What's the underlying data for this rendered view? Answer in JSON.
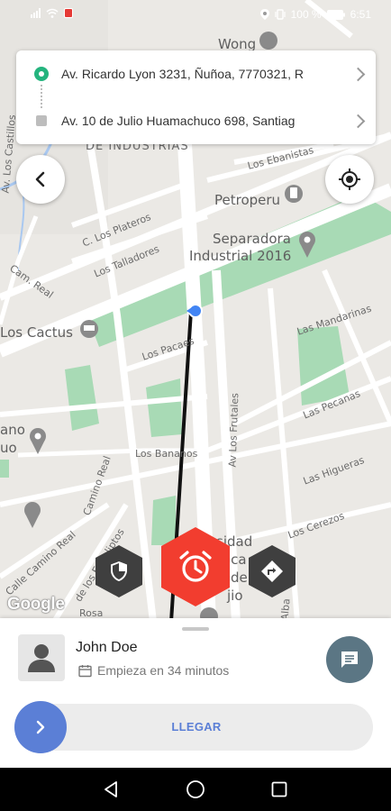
{
  "status_bar": {
    "battery": "100 %",
    "time": "6:51"
  },
  "route": {
    "origin_address": "Av. Ricardo Lyon 3231, Ñuñoa, 7770321, R",
    "destination_address": "Av. 10 de Julio Huamachuco 698, Santiag"
  },
  "map": {
    "labels": {
      "wong": "Wong",
      "de_industrias": "DE INDUSTRIAS",
      "los_ebanistas": "Los Ebanistas",
      "petroperu": "Petroperu",
      "los_plateros": "C. Los Plateros",
      "los_talladores": "Los Talladores",
      "separadora": "Separadora",
      "industrial_2016": "Industrial 2016",
      "cam_real": "Cam. Real",
      "los_cactus": "Los Cactus",
      "los_pacaes": "Los Pacaes",
      "las_mandarinas": "Las Mandarinas",
      "las_pecanas": "Las Pecanas",
      "av_los_frutales": "Av Los Frutales",
      "los_bananos": "Los Bananos",
      "las_higueras": "Las Higueras",
      "los_cerezos": "Los Cerezos",
      "camino_real": "Camino Real",
      "los_eucaliptos": "de los Eucaliptos",
      "calle_camino_real": "Calle Camino Real",
      "ano": "ano",
      "uo": "uo",
      "rosa": "Rosa",
      "alba": "Alba",
      "av_los_castillos": "Av. Los Castillos",
      "sidad": "sidad",
      "ica": "ica",
      "de": "de",
      "jio": "jio"
    },
    "attribution": "Google"
  },
  "driver": {
    "name": "John Doe",
    "starts_in": "Empieza en 34 minutos"
  },
  "slider": {
    "label": "LLEGAR"
  },
  "colors": {
    "accent_blue": "#5b7fd6",
    "sos_red": "#f23d2f",
    "hex_dark": "#3f3f3f",
    "chat_button": "#5b7684",
    "origin_green": "#24b47e",
    "park_green": "#a8dab5"
  },
  "icons": {
    "back": "chevron-left-icon",
    "locate": "crosshair-icon",
    "shield": "shield-icon",
    "alarm": "alarm-clock-icon",
    "directions": "turn-arrow-icon",
    "chat": "message-icon",
    "calendar": "calendar-icon",
    "person": "person-icon"
  }
}
